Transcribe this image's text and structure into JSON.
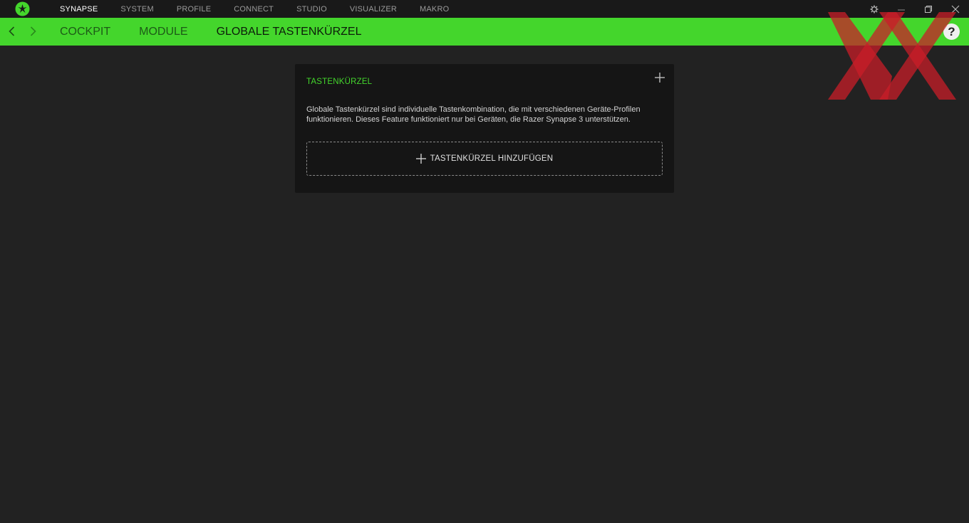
{
  "topnav": {
    "items": [
      {
        "label": "SYNAPSE",
        "active": true
      },
      {
        "label": "SYSTEM"
      },
      {
        "label": "PROFILE"
      },
      {
        "label": "CONNECT"
      },
      {
        "label": "STUDIO"
      },
      {
        "label": "VISUALIZER"
      },
      {
        "label": "MAKRO"
      }
    ]
  },
  "subnav": {
    "items": [
      {
        "label": "COCKPIT"
      },
      {
        "label": "MODULE"
      },
      {
        "label": "GLOBALE TASTENKÜRZEL",
        "active": true
      }
    ]
  },
  "help": {
    "label": "?"
  },
  "card": {
    "title": "TASTENKÜRZEL",
    "description": "Globale Tastenkürzel sind individuelle Tastenkombination, die mit verschiedenen Geräte-Profilen funktionieren. Dieses Feature funktioniert nur bei Geräten, die Razer Synapse 3 unterstützen.",
    "add_label": "TASTENKÜRZEL HINZUFÜGEN"
  },
  "colors": {
    "accent": "#44d62c",
    "background": "#222222",
    "card": "#151515",
    "titlebar": "#191919",
    "watermark": "#c81e28"
  },
  "icons": [
    "razer-logo",
    "settings-icon",
    "minimize-icon",
    "restore-icon",
    "close-icon",
    "back-arrow-icon",
    "forward-arrow-icon",
    "help-icon",
    "plus-icon"
  ]
}
